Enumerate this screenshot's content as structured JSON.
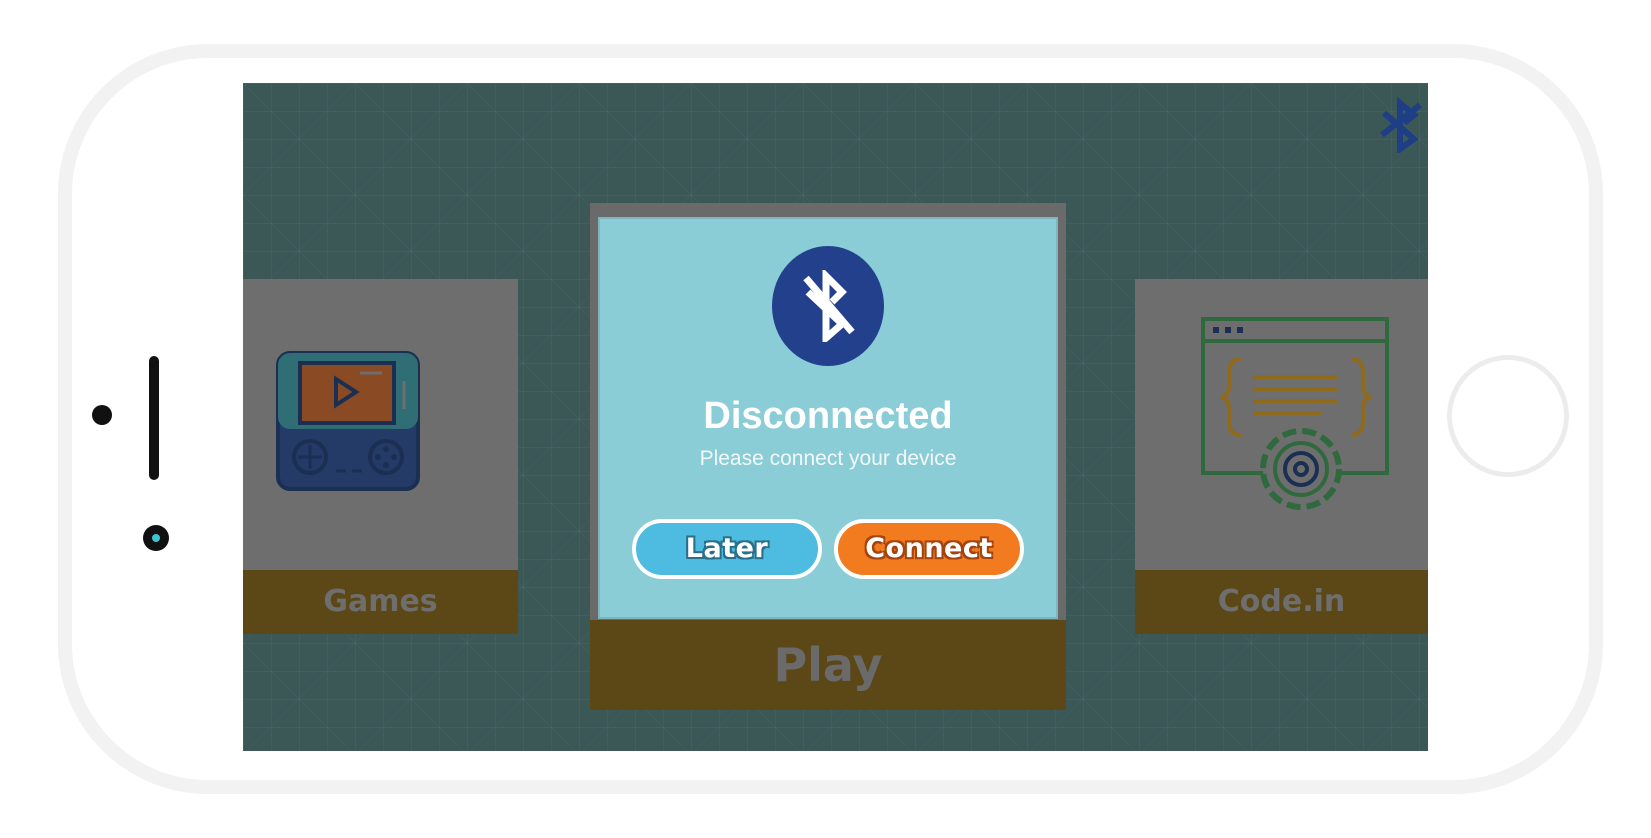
{
  "device": {
    "frame": "phone-landscape",
    "frame_color": "#f2f2f2",
    "camera_color": "#3fc3d0"
  },
  "screen": {
    "background_color": "#3b5857",
    "status_icon": "bluetooth-disabled-icon"
  },
  "cards": {
    "games": {
      "label": "Games",
      "icon": "handheld-console-icon"
    },
    "play": {
      "label": "Play"
    },
    "code": {
      "label": "Code.in",
      "icon": "code-window-gear-icon"
    }
  },
  "dialog": {
    "icon": "bluetooth-disabled-icon",
    "title": "Disconnected",
    "subtitle": "Please connect your device",
    "later_label": "Later",
    "connect_label": "Connect",
    "colors": {
      "background": "#8bcdd6",
      "icon_bg": "#22408c",
      "later": "#4dbce0",
      "connect": "#f27a1f"
    }
  }
}
